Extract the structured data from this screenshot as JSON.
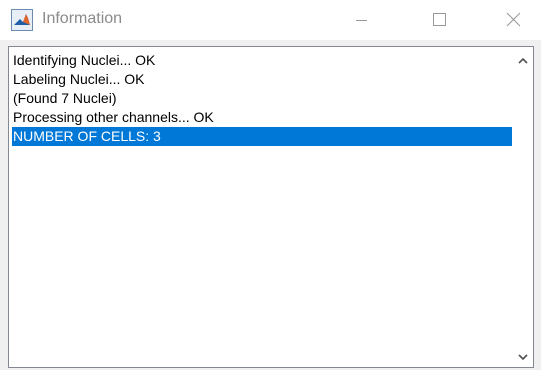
{
  "window": {
    "title": "Information",
    "icon": "matlab-icon",
    "controls": {
      "minimize_icon": "minimize-icon",
      "maximize_icon": "maximize-icon",
      "close_icon": "close-icon"
    }
  },
  "listbox": {
    "items": [
      "Identifying Nuclei... OK",
      "Labeling Nuclei... OK",
      "(Found 7 Nuclei)",
      "Processing other channels... OK",
      "NUMBER OF CELLS: 3"
    ],
    "selected_index": 4
  },
  "colors": {
    "selection": "#0078d7",
    "title_text": "#8a8a8a",
    "background": "#f0f0f0"
  }
}
